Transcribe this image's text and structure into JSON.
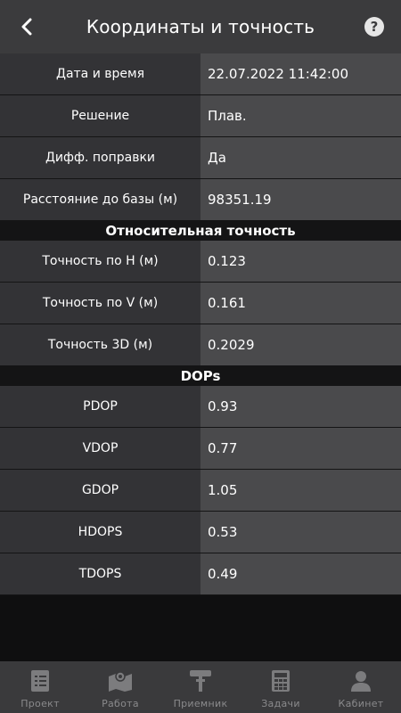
{
  "header": {
    "title": "Координаты и точность"
  },
  "rows_general": [
    {
      "label": "Дата и время",
      "value": "22.07.2022 11:42:00"
    },
    {
      "label": "Решение",
      "value": "Плав."
    },
    {
      "label": "Дифф. поправки",
      "value": "Да"
    },
    {
      "label": "Расстояние до базы (м)",
      "value": "98351.19"
    }
  ],
  "section_relative": "Относительная точность",
  "rows_relative": [
    {
      "label": "Точность по H (м)",
      "value": "0.123"
    },
    {
      "label": "Точность по V (м)",
      "value": "0.161"
    },
    {
      "label": "Точность 3D (м)",
      "value": "0.2029"
    }
  ],
  "section_dops": "DOPs",
  "rows_dops": [
    {
      "label": "PDOP",
      "value": "0.93"
    },
    {
      "label": "VDOP",
      "value": "0.77"
    },
    {
      "label": "GDOP",
      "value": "1.05"
    },
    {
      "label": "HDOPS",
      "value": "0.53"
    },
    {
      "label": "TDOPS",
      "value": "0.49"
    }
  ],
  "tabs": [
    {
      "label": "Проект",
      "icon": "project-icon"
    },
    {
      "label": "Работа",
      "icon": "map-icon"
    },
    {
      "label": "Приемник",
      "icon": "receiver-icon"
    },
    {
      "label": "Задачи",
      "icon": "calculator-icon"
    },
    {
      "label": "Кабинет",
      "icon": "user-icon"
    }
  ],
  "colors": {
    "header_bg": "#3b3b3d",
    "label_bg": "#333336",
    "value_bg": "#4a4a4c",
    "section_bg": "#141415",
    "tab_inactive": "#8a8a8c"
  }
}
